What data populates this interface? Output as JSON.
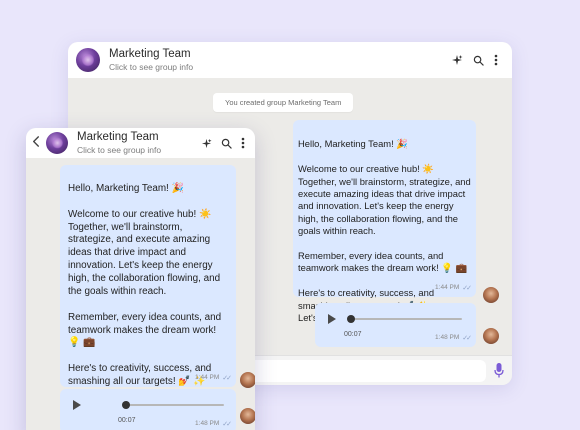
{
  "colors": {
    "page_bg": "#e9e6fb",
    "chat_bg": "#ecebe8",
    "bubble": "#dbe8ff",
    "header_bg": "#ffffff",
    "mic_accent": "#7b5cd6"
  },
  "back_window": {
    "header": {
      "title": "Marketing Team",
      "subtitle": "Click to see group info",
      "icons": [
        "sparkle-icon",
        "search-icon",
        "more-vertical-icon"
      ]
    },
    "system_message": "You created group Marketing Team",
    "text_message": {
      "body": "Hello, Marketing Team! 🎉\n\nWelcome to our creative hub! ☀️\nTogether, we'll brainstorm, strategize, and execute amazing ideas that drive impact and innovation. Let's keep the energy high, the collaboration flowing, and the goals within reach.\n\nRemember, every idea counts, and teamwork makes the dream work! 💡 💼\n\nHere's to creativity, success, and smashing all our targets! 💅 ✨\nLet's make it happen!",
      "time": "1:44 PM"
    },
    "voice_message": {
      "duration": "00:07",
      "time": "1:48 PM"
    },
    "input": {
      "placeholder": ""
    }
  },
  "front_window": {
    "header": {
      "title": "Marketing Team",
      "subtitle": "Click to see group info",
      "icons": [
        "back-arrow-icon",
        "sparkle-icon",
        "search-icon",
        "more-vertical-icon"
      ]
    },
    "text_message": {
      "body": "Hello, Marketing Team! 🎉\n\nWelcome to our creative hub! ☀️\nTogether, we'll brainstorm, strategize, and execute amazing ideas that drive impact and innovation. Let's keep the energy high, the collaboration flowing, and the goals within reach.\n\nRemember, every idea counts, and teamwork makes the dream work! 💡 💼\n\nHere's to creativity, success, and smashing all our targets! 💅 ✨\nLet's make it happen!",
      "time": "1:44 PM"
    },
    "voice_message": {
      "duration": "00:07",
      "time": "1:48 PM"
    }
  }
}
